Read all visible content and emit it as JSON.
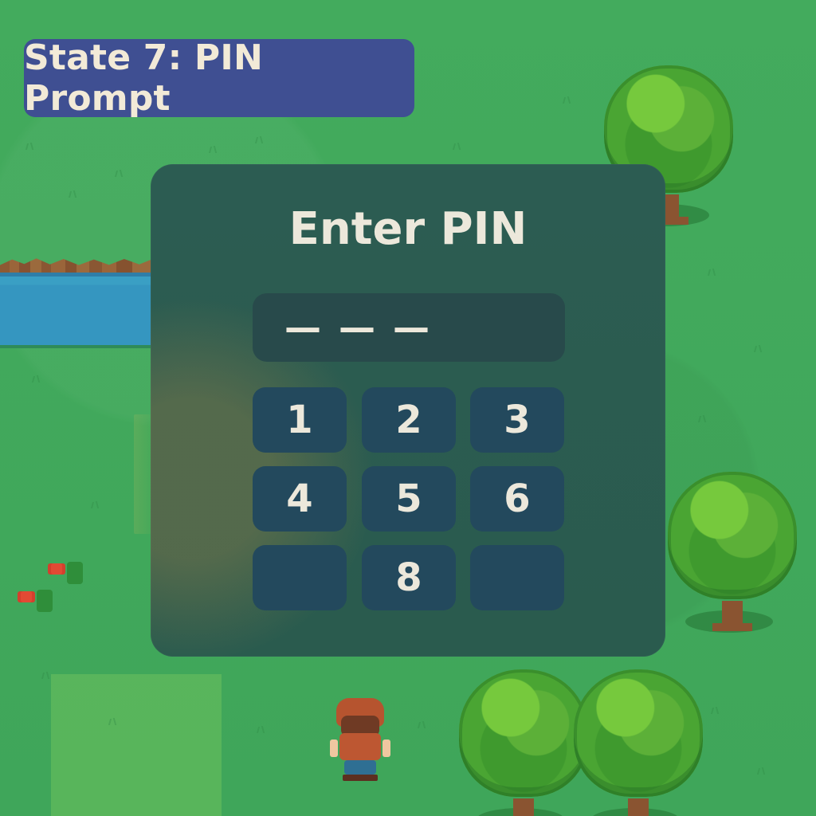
{
  "status_chip": {
    "text": "State 7: PIN Prompt"
  },
  "dialog": {
    "title": "Enter PIN",
    "pin_display": "— — —",
    "keys": [
      "1",
      "2",
      "3",
      "4",
      "5",
      "6",
      "",
      "8",
      ""
    ]
  },
  "colors": {
    "grass": "#3fa65a",
    "dialog_bg": "#2b5b50",
    "status_chip": "#3f4f92",
    "key_bg": "#23495d",
    "text_light": "#ece8db"
  },
  "icons": {
    "player_sprite": "player-character-icon",
    "tree": "tree-icon",
    "flower": "flower-icon"
  }
}
